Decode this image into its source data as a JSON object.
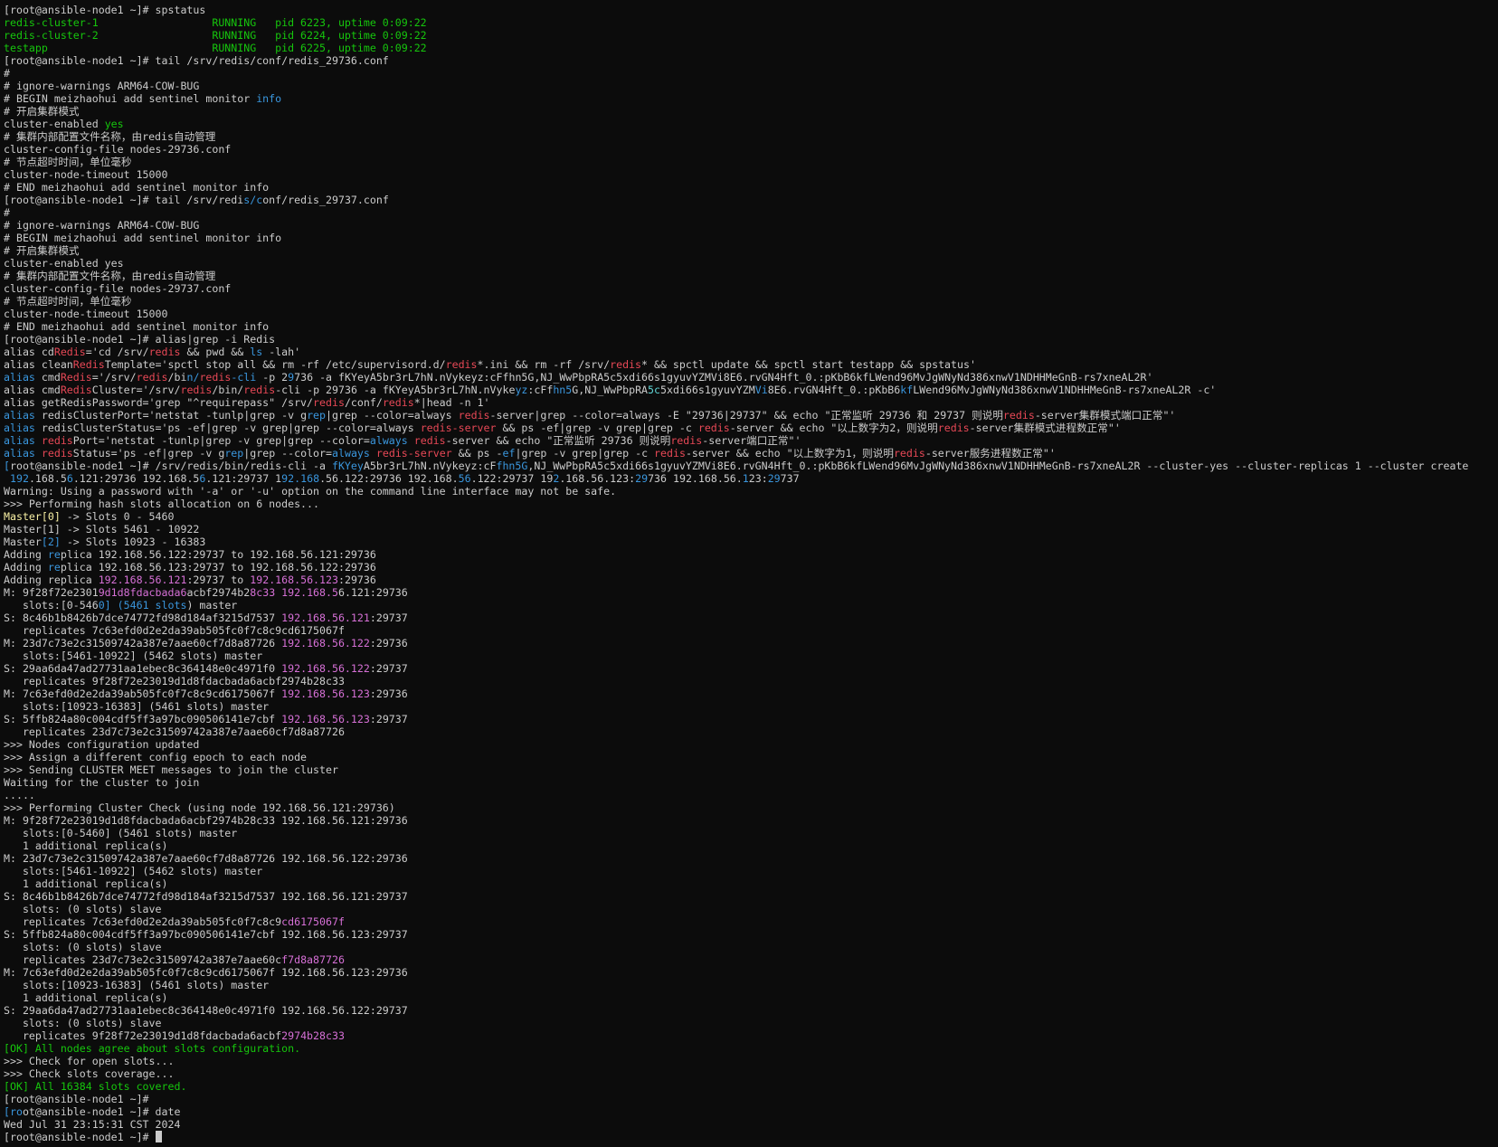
{
  "terminal": {
    "lines": [
      [
        {
          "t": "[root@ansible-node1 ~]# spstatus"
        }
      ],
      [
        {
          "t": "redis-cluster-1                  RUNNING   pid 6223, uptime 0:09:22",
          "c": "g"
        }
      ],
      [
        {
          "t": "redis-cluster-2                  RUNNING   pid 6224, uptime 0:09:22",
          "c": "g"
        }
      ],
      [
        {
          "t": "testapp                          RUNNING   pid 6225, uptime 0:09:22",
          "c": "g"
        }
      ],
      [
        {
          "t": "[root@ansible-node1 ~]# tail /srv/redis/conf/redis_29736.conf"
        }
      ],
      [
        {
          "t": "#"
        }
      ],
      [
        {
          "t": "# ignore-warnings ARM64-COW-BUG"
        }
      ],
      [
        {
          "t": "# BEGIN meizhaohui add sentinel monitor "
        },
        {
          "t": "info",
          "c": "bb"
        }
      ],
      [
        {
          "t": "# 开启集群模式"
        }
      ],
      [
        {
          "t": "cluster-enabled "
        },
        {
          "t": "yes",
          "c": "g"
        }
      ],
      [
        {
          "t": "# 集群内部配置文件名称，由redis自动管理"
        }
      ],
      [
        {
          "t": "cluster-config-file nodes-29736.conf"
        }
      ],
      [
        {
          "t": "# 节点超时时间，单位毫秒"
        }
      ],
      [
        {
          "t": "cluster-node-timeout 15000"
        }
      ],
      [
        {
          "t": "# END meizhaohui add sentinel monitor info"
        }
      ],
      [
        {
          "t": "[root@ansible-node1 ~]# tail /srv/redi"
        },
        {
          "t": "s/c",
          "c": "bb"
        },
        {
          "t": "onf/redis_29737.conf"
        }
      ],
      [
        {
          "t": "#"
        }
      ],
      [
        {
          "t": "# ignore-warnings ARM64-COW-BUG"
        }
      ],
      [
        {
          "t": "# BEGIN meizhaohui add sentinel monitor info"
        }
      ],
      [
        {
          "t": "# 开启集群模式"
        }
      ],
      [
        {
          "t": "cluster-enabled yes"
        }
      ],
      [
        {
          "t": "# 集群内部配置文件名称，由redis自动管理"
        }
      ],
      [
        {
          "t": "cluster-config-file nodes-29737.conf"
        }
      ],
      [
        {
          "t": "# 节点超时时间，单位毫秒"
        }
      ],
      [
        {
          "t": "cluster-node-timeout 15000"
        }
      ],
      [
        {
          "t": "# END meizhaohui add sentinel monitor info"
        }
      ],
      [
        {
          "t": "[root@ansible-node1 ~]# alias|grep -i Redis"
        }
      ],
      [
        {
          "t": "alias cd"
        },
        {
          "t": "Redis",
          "c": "r"
        },
        {
          "t": "='cd /srv/"
        },
        {
          "t": "redis",
          "c": "r"
        },
        {
          "t": " && pwd && "
        },
        {
          "t": "ls",
          "c": "bb"
        },
        {
          "t": " -lah'"
        }
      ],
      [
        {
          "t": "alias clean"
        },
        {
          "t": "Redis",
          "c": "r"
        },
        {
          "t": "Template='spctl stop all && rm -rf /etc/supervisord.d/"
        },
        {
          "t": "redis",
          "c": "r"
        },
        {
          "t": "*.ini && rm -rf /srv/"
        },
        {
          "t": "redis",
          "c": "r"
        },
        {
          "t": "* && spctl update && spctl start testapp && spstatus'"
        }
      ],
      [
        {
          "t": "alias",
          "c": "bb"
        },
        {
          "t": " cmd"
        },
        {
          "t": "Redis",
          "c": "r"
        },
        {
          "t": "='/srv/"
        },
        {
          "t": "redis",
          "c": "r"
        },
        {
          "t": "/bi"
        },
        {
          "t": "n/",
          "c": "bb"
        },
        {
          "t": "redis",
          "c": "r"
        },
        {
          "t": "-cli",
          "c": "bb"
        },
        {
          "t": " -p 2"
        },
        {
          "t": "9",
          "c": "bb"
        },
        {
          "t": "736 -a fKYeyA5br3rL7hN.nVykeyz:cFfhn5G,NJ_WwPbpRA5c5xdi66s1gyuvYZMVi8E6.rvGN4Hft_0.:pKbB6kfLWend96MvJgWNyNd386xnwV1NDHHMeGnB-rs7xneAL2R'"
        }
      ],
      [
        {
          "t": "alias cmd"
        },
        {
          "t": "Redis",
          "c": "r"
        },
        {
          "t": "Cluster='/srv/"
        },
        {
          "t": "redis",
          "c": "r"
        },
        {
          "t": "/bin/"
        },
        {
          "t": "redis",
          "c": "r"
        },
        {
          "t": "-cli -p 29736 -a fKYeyA5br3rL7hN.nVyke"
        },
        {
          "t": "yz",
          "c": "bb"
        },
        {
          "t": ":cFf"
        },
        {
          "t": "hn5",
          "c": "bb"
        },
        {
          "t": "G,NJ_WwPbpRA"
        },
        {
          "t": "5c",
          "c": "c"
        },
        {
          "t": "5xdi66s1gyuvYZM"
        },
        {
          "t": "Vi",
          "c": "bb"
        },
        {
          "t": "8E6.rvGN4Hft_0.:pKbB6"
        },
        {
          "t": "kf",
          "c": "bb"
        },
        {
          "t": "LWend96MvJgWNyNd386xnwV1NDHHMeGnB-rs7xneAL2R -c'"
        }
      ],
      [
        {
          "t": "alias getRedisPassword='grep \"^requirepass\" /srv/"
        },
        {
          "t": "redis",
          "c": "r"
        },
        {
          "t": "/conf/"
        },
        {
          "t": "redis",
          "c": "r"
        },
        {
          "t": "*|head -n 1'"
        }
      ],
      [
        {
          "t": "alias",
          "c": "bb"
        },
        {
          "t": " redisClusterPort='netstat -tunlp|grep -v g"
        },
        {
          "t": "rep",
          "c": "bb"
        },
        {
          "t": "|grep --color=always "
        },
        {
          "t": "redis",
          "c": "r"
        },
        {
          "t": "-server|grep --color=always -E \"29736|29737\" && echo \"正常监听 29736 和 29737 则说明"
        },
        {
          "t": "redis",
          "c": "r"
        },
        {
          "t": "-server集群模式端口正常\"'"
        }
      ],
      [
        {
          "t": "alias",
          "c": "bb"
        },
        {
          "t": " redisClusterStatus='ps -ef|grep -v grep|grep --color=always "
        },
        {
          "t": "redis-server",
          "c": "r"
        },
        {
          "t": " && ps -ef|grep -v grep|grep -c "
        },
        {
          "t": "redis",
          "c": "r"
        },
        {
          "t": "-server && echo \"以上数字为2，则说明"
        },
        {
          "t": "redis",
          "c": "r"
        },
        {
          "t": "-server集群模式进程数正常\"'"
        }
      ],
      [
        {
          "t": "alias",
          "c": "bb"
        },
        {
          "t": " "
        },
        {
          "t": "redis",
          "c": "r"
        },
        {
          "t": "Port='netstat -tunlp|grep -v grep|grep --color="
        },
        {
          "t": "always",
          "c": "bb"
        },
        {
          "t": " "
        },
        {
          "t": "redis",
          "c": "r"
        },
        {
          "t": "-server && echo \"正常监听 29736 则说明"
        },
        {
          "t": "redis",
          "c": "r"
        },
        {
          "t": "-server端口正常\"'"
        }
      ],
      [
        {
          "t": "alias ",
          "c": "bb"
        },
        {
          "t": "redis",
          "c": "r"
        },
        {
          "t": "Status='ps -ef|grep -v g"
        },
        {
          "t": "rep",
          "c": "bb"
        },
        {
          "t": "|grep --color="
        },
        {
          "t": "always",
          "c": "bb"
        },
        {
          "t": " "
        },
        {
          "t": "redis-server",
          "c": "r"
        },
        {
          "t": " && ps -"
        },
        {
          "t": "ef",
          "c": "bb"
        },
        {
          "t": "|grep -v grep|grep -c "
        },
        {
          "t": "redis",
          "c": "r"
        },
        {
          "t": "-server && echo \"以上数字为1，则说明"
        },
        {
          "t": "redis",
          "c": "r"
        },
        {
          "t": "-server服务进程数正常\"'"
        }
      ],
      [
        {
          "t": "[",
          "c": "bb"
        },
        {
          "t": "root@ansible-node1 ~]# /srv/redis/bin/redis-cli -a "
        },
        {
          "t": "fKYey",
          "c": "bb"
        },
        {
          "t": "A5br3rL7hN.nVykeyz:cF"
        },
        {
          "t": "fhn5G",
          "c": "bb"
        },
        {
          "t": ",NJ_WwPbpRA5c5xdi66s1gyuvYZMVi8E6.rvGN4Hft_0.:pKbB6kfLWend96MvJgWNyNd386xnwV1NDHHMeGnB-rs7xneAL2R --cluster-yes --cluster-replicas 1 --cluster create"
        }
      ],
      [
        {
          "t": " "
        },
        {
          "t": "192",
          "c": "bb"
        },
        {
          "t": ".168.5"
        },
        {
          "t": "6",
          "c": "bb"
        },
        {
          "t": ".121:29736 192.168.5"
        },
        {
          "t": "6",
          "c": "bb"
        },
        {
          "t": ".121:29737 1"
        },
        {
          "t": "92.168",
          "c": "bb"
        },
        {
          "t": ".56.122:29736 192.168."
        },
        {
          "t": "56",
          "c": "bb"
        },
        {
          "t": ".122:29737 19"
        },
        {
          "t": "2",
          "c": "bb"
        },
        {
          "t": ".168.56.123:"
        },
        {
          "t": "29",
          "c": "bb"
        },
        {
          "t": "736 192.168.56."
        },
        {
          "t": "1",
          "c": "bb"
        },
        {
          "t": "23:"
        },
        {
          "t": "29",
          "c": "bb"
        },
        {
          "t": "737"
        }
      ],
      [
        {
          "t": "Warning: Using a password with '-a' or '-u' option on the command line interface may not be safe."
        }
      ],
      [
        {
          "t": ">>> Performing hash slots allocation on 6 nodes..."
        }
      ],
      [
        {
          "t": "Master[0]",
          "c": "y"
        },
        {
          "t": " -> Slots 0 - 5460"
        }
      ],
      [
        {
          "t": "Master[1] -> Slots 5461 - 10922"
        }
      ],
      [
        {
          "t": "Master"
        },
        {
          "t": "[2]",
          "c": "bb"
        },
        {
          "t": " -> Slots 10923 - 16383"
        }
      ],
      [
        {
          "t": "Adding "
        },
        {
          "t": "re",
          "c": "bb"
        },
        {
          "t": "plica 192.168.56.122:29737 to 192.168.56.121:29736"
        }
      ],
      [
        {
          "t": "Adding "
        },
        {
          "t": "re",
          "c": "bb"
        },
        {
          "t": "plica 192.168.56.123:29737 to 192.168.56.122:29736"
        }
      ],
      [
        {
          "t": "Adding replica "
        },
        {
          "t": "192.168.56.121",
          "c": "m"
        },
        {
          "t": ":29737 to "
        },
        {
          "t": "192.168.56.123",
          "c": "m"
        },
        {
          "t": ":29736"
        }
      ],
      [
        {
          "t": "M: 9f28f72e2301"
        },
        {
          "t": "9d1d8fdacbada6",
          "c": "m"
        },
        {
          "t": "acbf2974b2"
        },
        {
          "t": "8c33 192.168.5",
          "c": "m"
        },
        {
          "t": "6.121:29736"
        }
      ],
      [
        {
          "t": "   slots:[0-546"
        },
        {
          "t": "0] (5461 slots",
          "c": "bb"
        },
        {
          "t": ") master"
        }
      ],
      [
        {
          "t": "S: 8c46b1b8426b7dce74772fd98d184af3215d7537 "
        },
        {
          "t": "192.168.56.121",
          "c": "m"
        },
        {
          "t": ":29737"
        }
      ],
      [
        {
          "t": "   replicates 7c63efd0d2e2da39ab505fc0f7c8c9cd6175067f"
        }
      ],
      [
        {
          "t": "M: 23d7c73e2c31509742a387e7aae60cf7d8a87726 "
        },
        {
          "t": "192.168.56.122",
          "c": "m"
        },
        {
          "t": ":29736"
        }
      ],
      [
        {
          "t": "   slots:[5461-10922] (5462 slots) master"
        }
      ],
      [
        {
          "t": "S: 29aa6da47ad27731aa1ebec8c364148e0c4971f0 "
        },
        {
          "t": "192.168.56.122",
          "c": "m"
        },
        {
          "t": ":29737"
        }
      ],
      [
        {
          "t": "   replicates 9f28f72e23019d1d8fdacbada6acbf2974b28c33"
        }
      ],
      [
        {
          "t": "M: 7c63efd0d2e2da39ab505fc0f7c8c9cd6175067f "
        },
        {
          "t": "192.168.56.123",
          "c": "m"
        },
        {
          "t": ":29736"
        }
      ],
      [
        {
          "t": "   slots:[10923-16383] (5461 slots) master"
        }
      ],
      [
        {
          "t": "S: 5ffb824a80c004cdf5ff3a97bc090506141e7cbf "
        },
        {
          "t": "192.168.56.123",
          "c": "m"
        },
        {
          "t": ":29737"
        }
      ],
      [
        {
          "t": "   replicates 23d7c73e2c31509742a387e7aae60cf7d8a87726"
        }
      ],
      [
        {
          "t": ">>> Nodes configuration updated"
        }
      ],
      [
        {
          "t": ">>> Assign a different config epoch to each node"
        }
      ],
      [
        {
          "t": ">>> Sending CLUSTER MEET messages to join the cluster"
        }
      ],
      [
        {
          "t": "Waiting for the cluster to join"
        }
      ],
      [
        {
          "t": "....."
        }
      ],
      [
        {
          "t": ">>> Performing Cluster Check (using node 192.168.56.121:29736)"
        }
      ],
      [
        {
          "t": "M: 9f28f72e23019d1d8fdacbada6acbf2974b28c33 192.168.56.121:29736"
        }
      ],
      [
        {
          "t": "   slots:[0-5460] (5461 slots) master"
        }
      ],
      [
        {
          "t": "   1 additional replica(s)"
        }
      ],
      [
        {
          "t": "M: 23d7c73e2c31509742a387e7aae60cf7d8a87726 192.168.56.122:29736"
        }
      ],
      [
        {
          "t": "   slots:[5461-10922] (5462 slots) master"
        }
      ],
      [
        {
          "t": "   1 additional replica(s)"
        }
      ],
      [
        {
          "t": "S: 8c46b1b8426b7dce74772fd98d184af3215d7537 192.168.56.121:29737"
        }
      ],
      [
        {
          "t": "   slots: (0 slots) slave"
        }
      ],
      [
        {
          "t": "   replicates 7c63efd0d2e2da39ab505fc0f7c8c9"
        },
        {
          "t": "cd6175067f",
          "c": "m"
        }
      ],
      [
        {
          "t": "S: 5ffb824a80c004cdf5ff3a97bc090506141e7cbf 192.168.56.123:29737"
        }
      ],
      [
        {
          "t": "   slots: (0 slots) slave"
        }
      ],
      [
        {
          "t": "   replicates 23d7c73e2c31509742a387e7aae60c"
        },
        {
          "t": "f7d8a87726",
          "c": "m"
        }
      ],
      [
        {
          "t": "M: 7c63efd0d2e2da39ab505fc0f7c8c9cd6175067f 192.168.56.123:29736"
        }
      ],
      [
        {
          "t": "   slots:[10923-16383] (5461 slots) master"
        }
      ],
      [
        {
          "t": "   1 additional replica(s)"
        }
      ],
      [
        {
          "t": "S: 29aa6da47ad27731aa1ebec8c364148e0c4971f0 192.168.56.122:29737"
        }
      ],
      [
        {
          "t": "   slots: (0 slots) slave"
        }
      ],
      [
        {
          "t": "   replicates 9f28f72e23019d1d8fdacbada6acbf"
        },
        {
          "t": "2974b28c33",
          "c": "m"
        }
      ],
      [
        {
          "t": "[OK] All nodes agree about slots configuration.",
          "c": "g"
        }
      ],
      [
        {
          "t": ">>> Check for open slots..."
        }
      ],
      [
        {
          "t": ">>> Check slots coverage..."
        }
      ],
      [
        {
          "t": "[OK] All 16384 slots covered.",
          "c": "g"
        }
      ],
      [
        {
          "t": "[root@ansible-node1 ~]#"
        }
      ],
      [
        {
          "t": "[ro",
          "c": "bb"
        },
        {
          "t": "ot@ansible-node1 ~]# date"
        }
      ],
      [
        {
          "t": "Wed Jul 31 23:15:31 CST 2024"
        }
      ],
      [
        {
          "t": "[root@ansible-node1 ~]# "
        }
      ]
    ]
  },
  "colors": {
    "background": "#0c0c0c",
    "foreground": "#cccccc",
    "green": "#16c60c",
    "red": "#e74856",
    "blue": "#3a96dd",
    "magenta": "#d670d6",
    "yellow": "#f9f1a5",
    "cyan": "#61d6d6"
  }
}
